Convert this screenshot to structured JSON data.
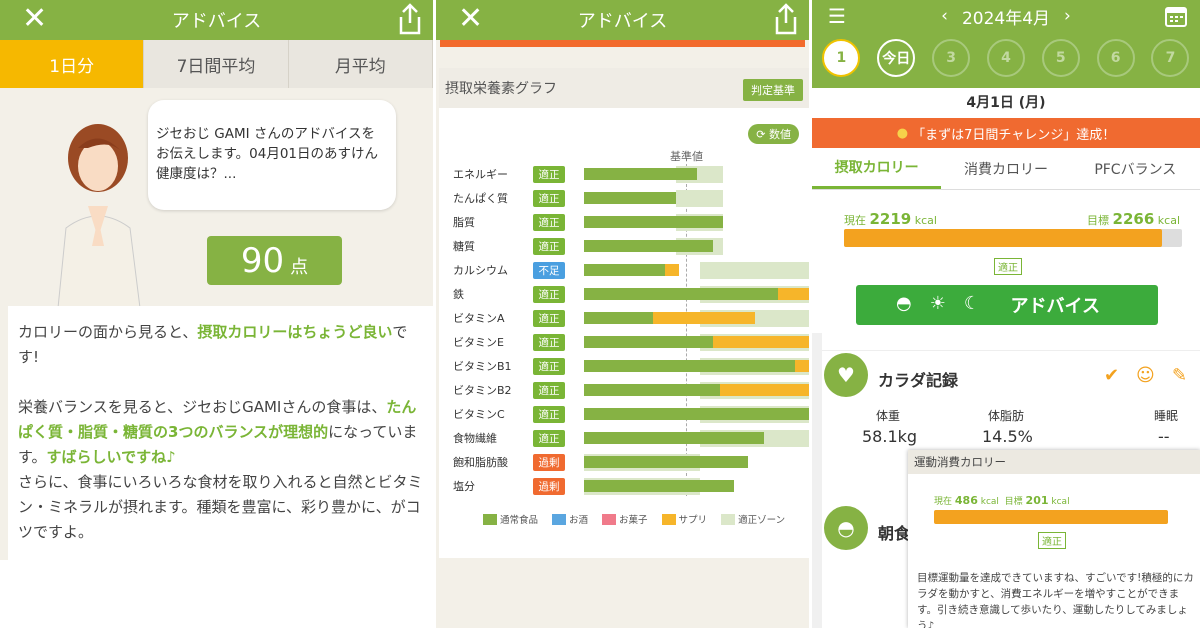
{
  "p1": {
    "title": "アドバイス",
    "tabs": [
      "1日分",
      "7日間平均",
      "月平均"
    ],
    "bubble": "ジセおじ GAMI さんのアドバイスをお伝えします。04月01日のあすけん健康度は？...",
    "score": "90",
    "score_unit": "点",
    "adv_a": "カロリーの面から見ると、",
    "adv_b": "摂取カロリーはちょうど良い",
    "adv_c": "です!",
    "adv_d": "栄養バランスを見ると、ジセおじGAMIさんの食事は、",
    "adv_e": "たんぱく質・脂質・糖質の3つのバランスが理想的",
    "adv_f": "になっています。",
    "adv_g": "すばらしいですね♪",
    "adv_h": "さらに、食事にいろいろな食材を取り入れると自然とビタミン・ミネラルが摂れます。種類を豊富に、彩り豊かに、がコツですよ。"
  },
  "p2": {
    "title": "アドバイス",
    "graph_title": "摂取栄養素グラフ",
    "criteria_btn": "判定基準",
    "value_btn": "数値",
    "baseline_label": "基準値",
    "legend": [
      "通常食品",
      "お酒",
      "お菓子",
      "サプリ",
      "適正ゾーン"
    ]
  },
  "chart_data": {
    "type": "bar",
    "title": "摂取栄養素グラフ",
    "reference_label": "基準値",
    "unit": "% of 基準値 (approx.)",
    "rows": [
      {
        "name": "エネルギー",
        "status": "適正",
        "food": 98,
        "supp": 0,
        "zone": [
          80,
          120
        ]
      },
      {
        "name": "たんぱく質",
        "status": "適正",
        "food": 80,
        "supp": 0,
        "zone": [
          80,
          120
        ]
      },
      {
        "name": "脂質",
        "status": "適正",
        "food": 120,
        "supp": 0,
        "zone": [
          80,
          120
        ]
      },
      {
        "name": "糖質",
        "status": "適正",
        "food": 112,
        "supp": 0,
        "zone": [
          80,
          120
        ]
      },
      {
        "name": "カルシウム",
        "status": "不足",
        "food": 70,
        "supp": 12,
        "zone": [
          100,
          200
        ]
      },
      {
        "name": "鉄",
        "status": "適正",
        "food": 168,
        "supp": 32,
        "zone": [
          100,
          200
        ]
      },
      {
        "name": "ビタミンA",
        "status": "適正",
        "food": 60,
        "supp": 88,
        "zone": [
          100,
          200
        ]
      },
      {
        "name": "ビタミンE",
        "status": "適正",
        "food": 112,
        "supp": 88,
        "zone": [
          100,
          200
        ]
      },
      {
        "name": "ビタミンB1",
        "status": "適正",
        "food": 183,
        "supp": 17,
        "zone": [
          100,
          200
        ]
      },
      {
        "name": "ビタミンB2",
        "status": "適正",
        "food": 118,
        "supp": 82,
        "zone": [
          100,
          200
        ]
      },
      {
        "name": "ビタミンC",
        "status": "適正",
        "food": 198,
        "supp": 2,
        "zone": [
          100,
          200
        ]
      },
      {
        "name": "食物繊維",
        "status": "適正",
        "food": 156,
        "supp": 0,
        "zone": [
          100,
          200
        ]
      },
      {
        "name": "飽和脂肪酸",
        "status": "過剰",
        "food": 142,
        "supp": 0,
        "zone": [
          0,
          100
        ]
      },
      {
        "name": "塩分",
        "status": "過剰",
        "food": 130,
        "supp": 0,
        "zone": [
          0,
          100
        ]
      }
    ],
    "colors": {
      "food": "#86b244",
      "supp": "#f6b52a",
      "zone": "#dbe7c9",
      "ok": "#7ab536",
      "low": "#4a9fe0",
      "high": "#f06a30"
    }
  },
  "p3": {
    "month": "2024年4月",
    "days": [
      "1",
      "今日",
      "3",
      "4",
      "5",
      "6",
      "7"
    ],
    "date": "4月1日 (月)",
    "challenge": "「まずは7日間チャレンジ」達成！",
    "tabs": [
      "摂取カロリー",
      "消費カロリー",
      "PFCバランス"
    ],
    "now_label": "現在",
    "now_val": "2219",
    "goal_label": "目標",
    "goal_val": "2266",
    "unit": "kcal",
    "fill_fraction": 0.94,
    "status": "適正",
    "advice_btn": "アドバイス",
    "body_title": "カラダ記録",
    "weight_label": "体重",
    "weight": "58.1kg",
    "fat_label": "体脂肪",
    "fat": "14.5%",
    "sleep_label": "睡眠",
    "sleep": "--",
    "breakfast": "朝食",
    "popup_title": "運動消費カロリー",
    "p_now_val": "486",
    "p_goal_val": "201",
    "p_status": "適正",
    "popup_text": "目標運動量を達成できていますね、すごいです!積極的にカラダを動かすと、消費エネルギーを増やすことができます。引き続き意識して歩いたり、運動したりしてみましょう♪"
  }
}
